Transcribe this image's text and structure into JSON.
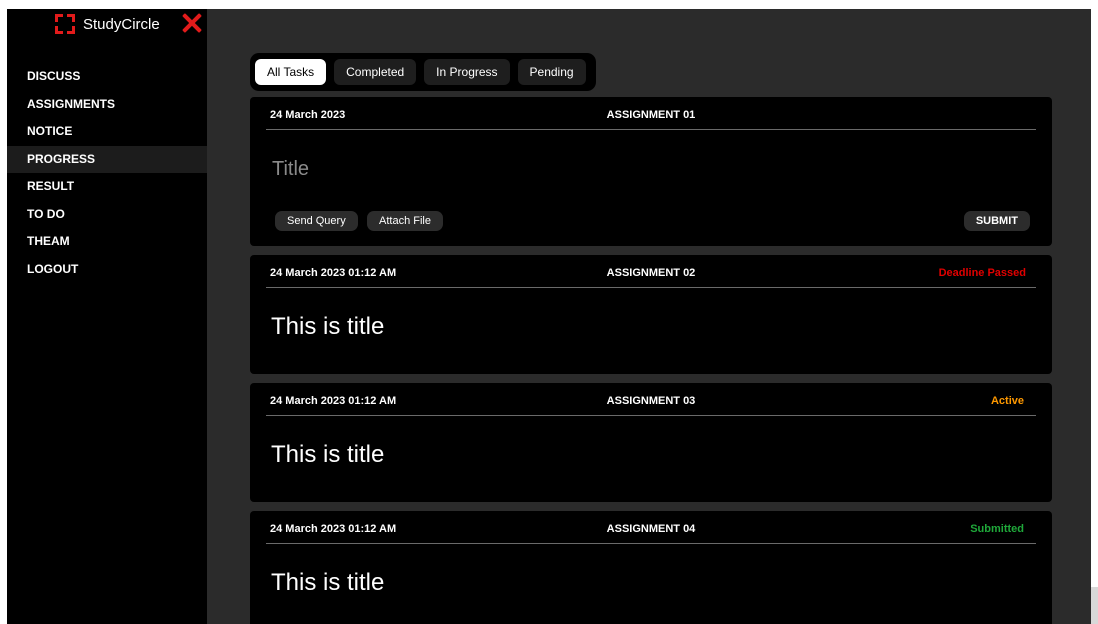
{
  "brand": {
    "name": "StudyCircle"
  },
  "sidebar": {
    "items": [
      {
        "label": "DISCUSS"
      },
      {
        "label": "ASSIGNMENTS"
      },
      {
        "label": "NOTICE"
      },
      {
        "label": "PROGRESS"
      },
      {
        "label": "RESULT"
      },
      {
        "label": "TO DO"
      },
      {
        "label": "THEAM"
      },
      {
        "label": "LOGOUT"
      }
    ],
    "active": "PROGRESS"
  },
  "tabs": [
    {
      "label": "All Tasks"
    },
    {
      "label": "Completed"
    },
    {
      "label": "In Progress"
    },
    {
      "label": "Pending"
    }
  ],
  "active_tab": "All Tasks",
  "assignments": [
    {
      "date": "24 March 2023",
      "name": "ASSIGNMENT 01",
      "title_placeholder": "Title",
      "send_query_label": "Send Query",
      "attach_file_label": "Attach File",
      "submit_label": "SUBMIT"
    },
    {
      "date": "24 March 2023  01:12 AM",
      "name": "ASSIGNMENT 02",
      "status": "Deadline Passed",
      "title": "This is title"
    },
    {
      "date": "24 March 2023  01:12 AM",
      "name": "ASSIGNMENT 03",
      "status": "Active",
      "title": "This is title"
    },
    {
      "date": "24 March 2023  01:12 AM",
      "name": "ASSIGNMENT 04",
      "status": "Submitted",
      "title": "This is title"
    }
  ],
  "colors": {
    "accent": "#e21b1b",
    "deadline_passed": "#e00000",
    "active": "#ff9900",
    "submitted": "#1fa83a"
  },
  "icons": {
    "logo": "studycircle-logo-icon",
    "close": "close-icon"
  }
}
